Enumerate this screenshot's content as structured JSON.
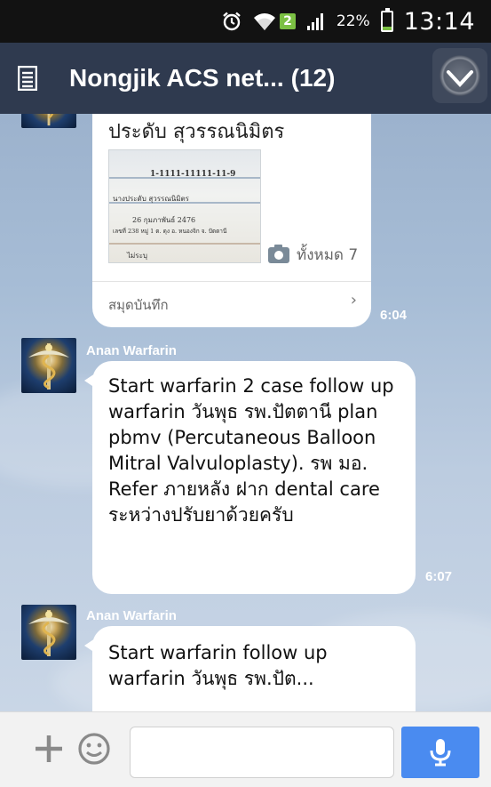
{
  "status_bar": {
    "icons": [
      "alarm-icon",
      "wifi-icon",
      "sim-2-badge",
      "signal-icon",
      "battery-icon"
    ],
    "sim_badge": "2",
    "battery_percent": "22%",
    "battery_level": 0.22,
    "time": "13:14"
  },
  "header": {
    "title": "Nongjik ACS net...",
    "member_count": "(12)",
    "menu_icon": "notes-icon",
    "action_icon": "check-icon"
  },
  "messages": [
    {
      "type": "note",
      "title": "ประดับ สุวรรณนิมิตร",
      "photo_text": {
        "line1": "1-1111-11111-11-9",
        "line2": "นางประดับ สุวรรณนิมิตร",
        "line3": "26 กุมภาพันธ์ 2476",
        "line4": "เลขที่ 238 หมู่ 1 ต. ดุง อ. หนองจิก จ. ปัตตานี",
        "line5": "ไม่ระบุ"
      },
      "photo_count_label": "ทั้งหมด 7",
      "footer_label": "สมุดบันทึก",
      "time": "6:04"
    },
    {
      "type": "text",
      "sender": "Anan Warfarin",
      "text": "Start warfarin 2 case follow up warfarin วันพุธ  รพ.ปัตตานี plan pbmv (Percutaneous Balloon Mitral Valvuloplasty). รพ มอ. Refer ภายหลัง ฝาก dental care ระหว่างปรับยาด้วยครับ",
      "time": "6:07"
    },
    {
      "type": "text",
      "sender": "Anan Warfarin",
      "text": "Start warfarin follow up warfarin วันพุธ  รพ.ปัต...",
      "time": ""
    }
  ],
  "input_bar": {
    "add_icon": "plus-icon",
    "emoji_icon": "smiley-icon",
    "input_value": "",
    "mic_icon": "microphone-icon"
  },
  "colors": {
    "header": "#2f3a4f",
    "chat_background": "#9db3cc",
    "mic_button": "#4a8bf0"
  }
}
